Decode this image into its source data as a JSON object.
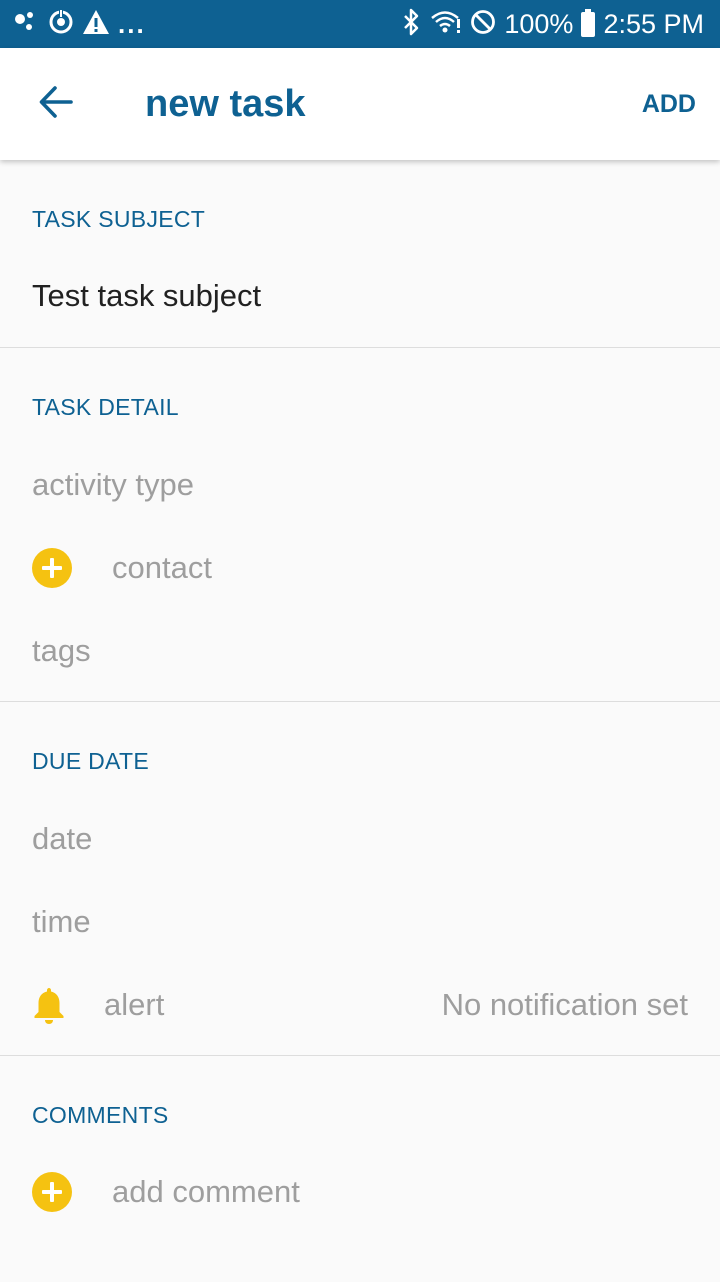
{
  "status_bar": {
    "left_dots": "...",
    "battery_percent": "100%",
    "time": "2:55 PM"
  },
  "app_bar": {
    "title": "new task",
    "action_label": "ADD"
  },
  "sections": {
    "subject": {
      "header": "TASK SUBJECT",
      "value": "Test task subject"
    },
    "detail": {
      "header": "TASK DETAIL",
      "activity_type_placeholder": "activity type",
      "contact_placeholder": "contact",
      "tags_placeholder": "tags"
    },
    "due_date": {
      "header": "DUE DATE",
      "date_placeholder": "date",
      "time_placeholder": "time",
      "alert_label": "alert",
      "alert_value": "No notification set"
    },
    "comments": {
      "header": "COMMENTS",
      "add_comment_placeholder": "add comment"
    }
  },
  "colors": {
    "primary": "#0e6192",
    "accent": "#f5c211",
    "hint_text": "#9e9e9e",
    "body_text": "#212121",
    "background": "#fafafa"
  },
  "icons": {
    "back": "arrow-left-icon",
    "add_contact": "plus-circle-icon",
    "alert": "bell-icon",
    "add_comment": "plus-circle-icon"
  }
}
